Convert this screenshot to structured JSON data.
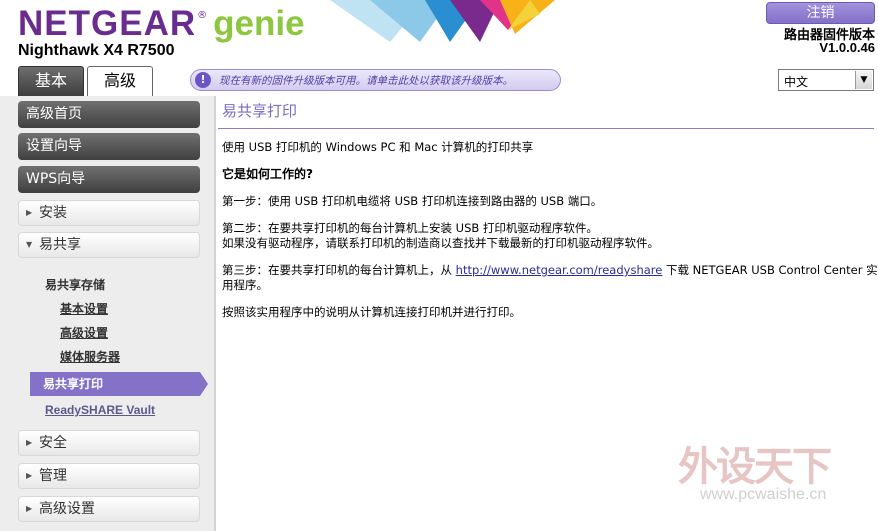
{
  "brand": {
    "name": "NETGEAR",
    "reg": "®",
    "product": "genie",
    "model": "Nighthawk X4 R7500"
  },
  "header": {
    "logout_label": "注销",
    "firmware_label": "路由器固件版本",
    "firmware_version": "V1.0.0.46",
    "tabs": [
      {
        "label": "基本"
      },
      {
        "label": "高级"
      }
    ],
    "update_icon": "!",
    "update_text": "现在有新的固件升级版本可用。请单击此处以获取该升级版本。",
    "language": {
      "selected": "中文",
      "arrow": "▼"
    }
  },
  "sidebar": {
    "dark_items": [
      {
        "label": "高级首页"
      },
      {
        "label": "设置向导"
      },
      {
        "label": "WPS向导"
      }
    ],
    "sections": {
      "install": {
        "label": "安装",
        "arrow": "▶"
      },
      "readyshare": {
        "label": "易共享",
        "arrow": "▼"
      },
      "security": {
        "label": "安全",
        "arrow": "▶"
      },
      "admin": {
        "label": "管理",
        "arrow": "▶"
      },
      "advanced_setup": {
        "label": "高级设置",
        "arrow": "▶"
      }
    },
    "storage": {
      "label": "易共享存储",
      "items": [
        {
          "label": "基本设置"
        },
        {
          "label": "高级设置"
        },
        {
          "label": "媒体服务器"
        }
      ]
    },
    "active_item": "易共享打印",
    "vault_item": "ReadySHARE Vault"
  },
  "main": {
    "title": "易共享打印",
    "intro": "使用 USB 打印机的 Windows PC 和 Mac 计算机的打印共享",
    "how_title": "它是如何工作的?",
    "step1": "第一步：使用 USB 打印机电缆将 USB 打印机连接到路由器的 USB 端口。",
    "step2_line1": "第二步：在要共享打印机的每台计算机上安装 USB 打印机驱动程序软件。",
    "step2_line2": "如果没有驱动程序，请联系打印机的制造商以查找并下载最新的打印机驱动程序软件。",
    "step3_prefix": "第三步：在要共享打印机的每台计算机上，从 ",
    "step3_link": "http://www.netgear.com/readyshare",
    "step3_suffix": " 下载 NETGEAR USB Control Center 实",
    "step3_line2": "用程序。",
    "final": "按照该实用程序中的说明从计算机连接打印机并进行打印。"
  },
  "watermark": {
    "text": "外设天下",
    "url": "www.pcwaishe.cn"
  },
  "colors": {
    "brand_purple": "#6a2d8f",
    "genie_green": "#8dc63f",
    "accent_purple": "#8472c8"
  }
}
